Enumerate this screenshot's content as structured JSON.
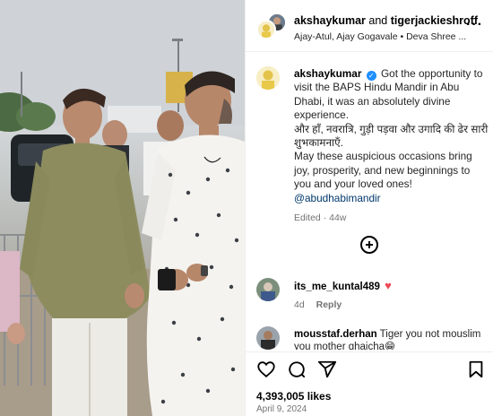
{
  "header": {
    "user1": "akshaykumar",
    "and_text": "and",
    "user2": "tigerjackieshroff",
    "subtitle": "Ajay-Atul, Ajay Gogavale • Deva Shree ..."
  },
  "caption": {
    "username": "akshaykumar",
    "text": "Got the opportunity to visit the BAPS Hindu Mandir in Abu Dhabi, it was an absolutely divine experience.",
    "hindi": "और हाँ, नवरात्रि, गुड़ी पड़वा और उगादि की ढेर सारी शुभकामनाएँ.",
    "wish": "May these auspicious occasions bring joy, prosperity, and new beginnings to you and your loved ones!",
    "mention": "@abudhabimandir",
    "edited": "Edited · 44w"
  },
  "comments": [
    {
      "username": "its_me_kuntal489",
      "text": "",
      "time": "4d",
      "reply": "Reply"
    },
    {
      "username": "mousstaf.derhan",
      "text": "Tiger you not mouslim you mother ghaicha😁"
    }
  ],
  "post": {
    "likes": "4,393,005 likes",
    "date": "April 9, 2024"
  },
  "icons": {
    "like": "heart-icon",
    "comment": "comment-icon",
    "share": "share-icon",
    "save": "bookmark-icon",
    "more": "more-options-icon",
    "load_more": "plus-circle-icon",
    "verified": "verified-badge-icon"
  },
  "colors": {
    "verified": "#1e8fff",
    "mention": "#00376b",
    "heart": "#ed4956",
    "muted": "#737373"
  }
}
